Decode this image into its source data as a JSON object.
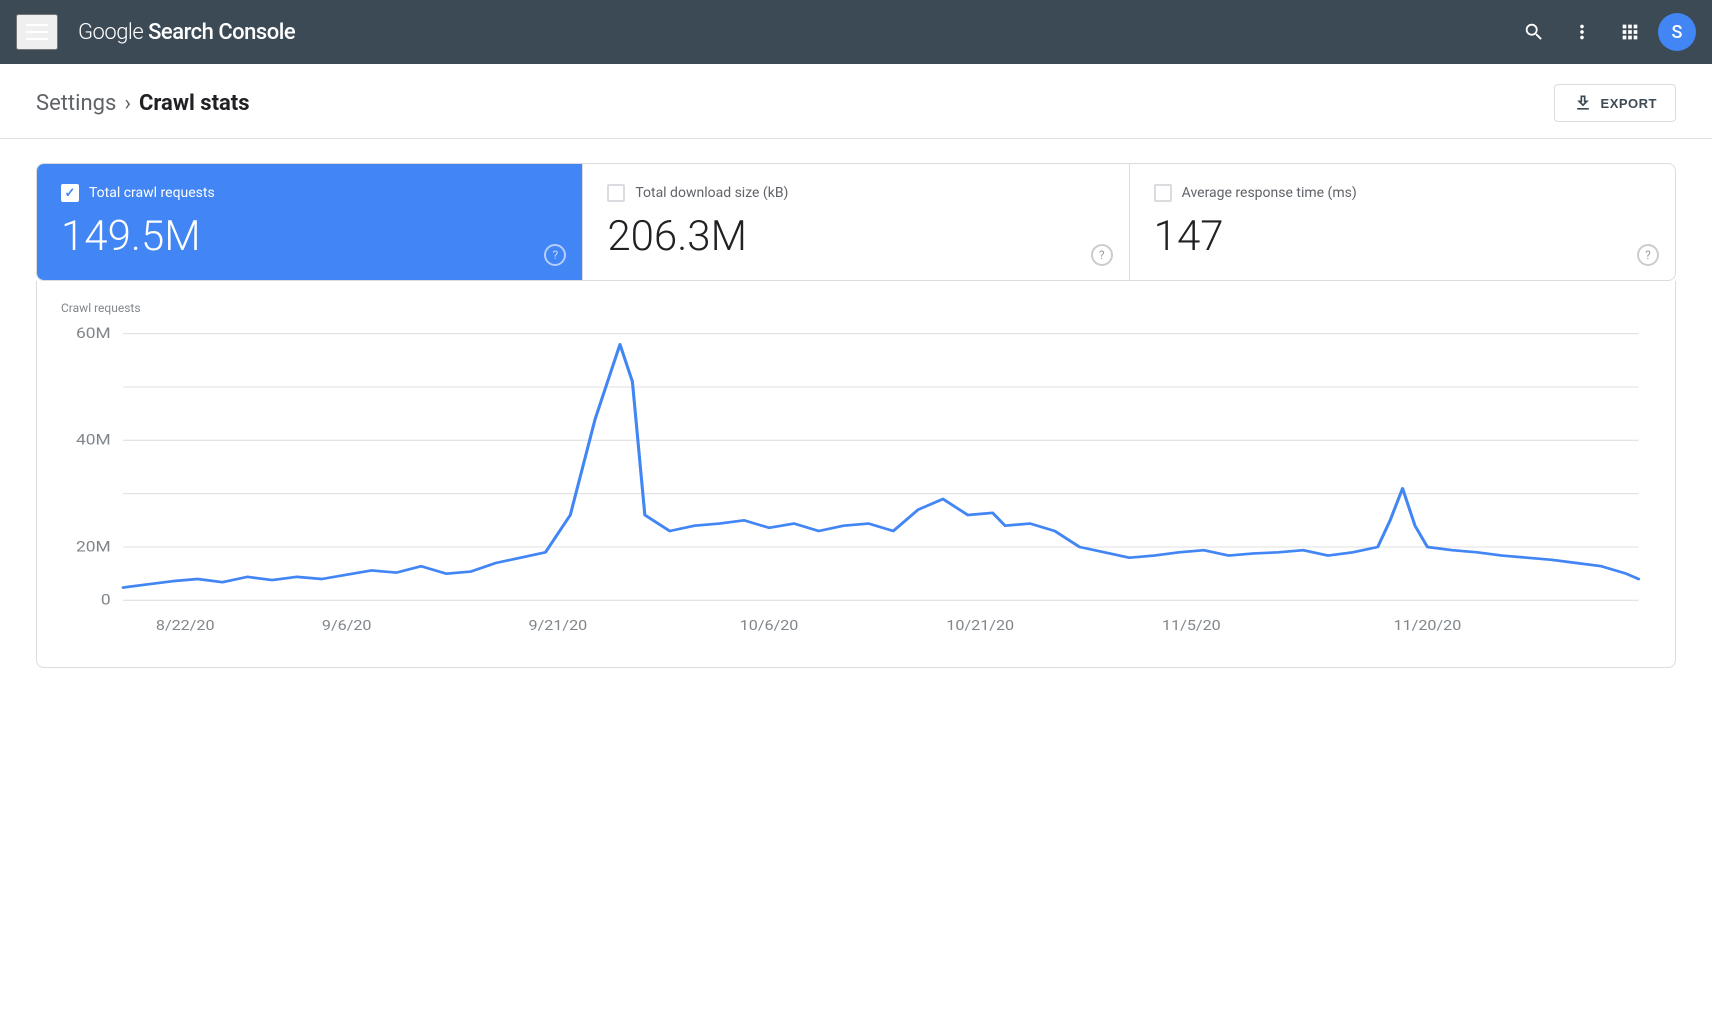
{
  "header": {
    "title": "Google Search Console",
    "title_normal": "Google ",
    "title_bold": "Search Console",
    "avatar_letter": "S"
  },
  "breadcrumb": {
    "settings_label": "Settings",
    "separator": ">",
    "current_label": "Crawl stats",
    "export_label": "EXPORT"
  },
  "stat_cards": [
    {
      "id": "total_crawl_requests",
      "label": "Total crawl requests",
      "value": "149.5M",
      "active": true,
      "checked": true
    },
    {
      "id": "total_download_size",
      "label": "Total download size (kB)",
      "value": "206.3M",
      "active": false,
      "checked": false
    },
    {
      "id": "avg_response_time",
      "label": "Average response time (ms)",
      "value": "147",
      "active": false,
      "checked": false
    }
  ],
  "chart": {
    "title": "Crawl requests",
    "y_labels": [
      "60M",
      "40M",
      "20M",
      "0"
    ],
    "x_labels": [
      "8/22/20",
      "9/6/20",
      "9/21/20",
      "10/6/20",
      "10/21/20",
      "11/5/20",
      "11/20/20"
    ],
    "line_color": "#4285f4",
    "grid_color": "#e0e0e0"
  }
}
